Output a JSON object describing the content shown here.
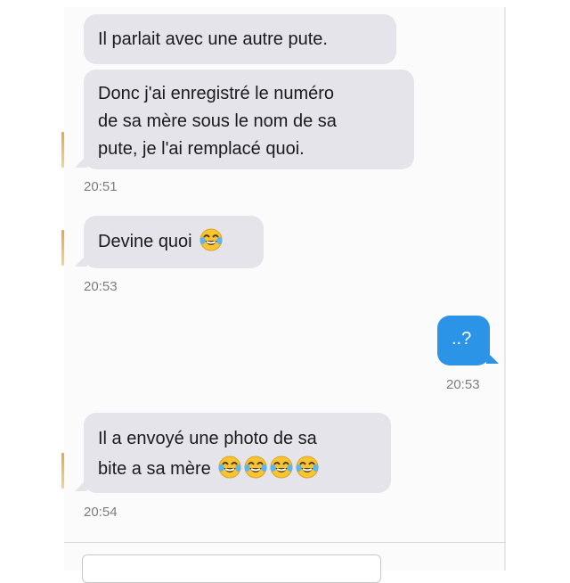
{
  "conversation": {
    "messages": [
      {
        "direction": "incoming",
        "text": "Il parlait avec une autre pute."
      },
      {
        "direction": "incoming",
        "lines": [
          "Donc j'ai enregistré le numéro",
          "de sa mère sous le nom de sa",
          "pute, je l'ai remplacé quoi."
        ]
      },
      {
        "direction": "incoming",
        "text": "Devine quoi"
      },
      {
        "direction": "outgoing",
        "text": "..?"
      },
      {
        "direction": "incoming",
        "lines": [
          "Il a envoyé une photo de sa",
          "bite a sa mère"
        ]
      }
    ],
    "timestamps": [
      "20:51",
      "20:53",
      "20:53",
      "20:54"
    ],
    "emoji": "tears-of-joy-emoji"
  },
  "colors": {
    "incoming_bubble": "#e4e4ea",
    "outgoing_bubble": "#2c94e6",
    "timestamp": "#7d7d7d"
  },
  "composer": {
    "placeholder": ""
  }
}
